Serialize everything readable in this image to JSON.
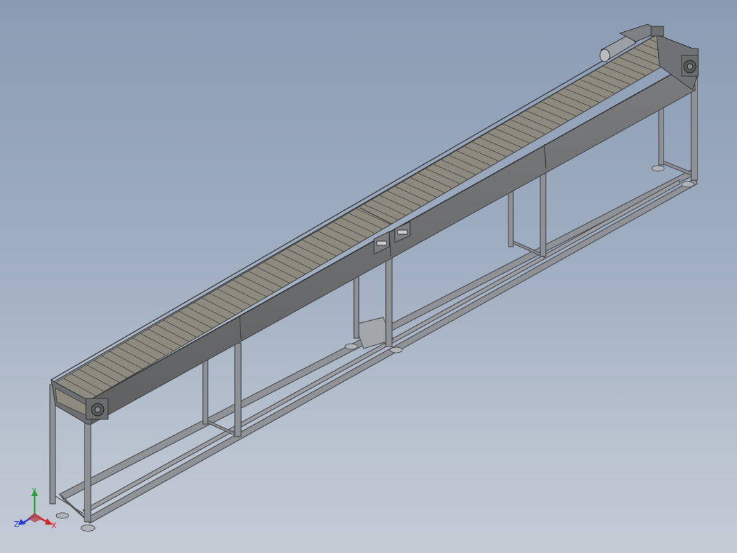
{
  "viewport": {
    "background_top": "#8a9bb3",
    "background_bottom": "#c4cbd5"
  },
  "model": {
    "name": "slat-chain-conveyor",
    "frame_color": "#5a5c5e",
    "slat_color": "#8d8a80",
    "slat_count": 78
  },
  "triad": {
    "x_label": "X",
    "y_label": "Y",
    "z_label": "Z",
    "x_color": "#d4242a",
    "y_color": "#2aa33a",
    "z_color": "#2a3ad4"
  }
}
